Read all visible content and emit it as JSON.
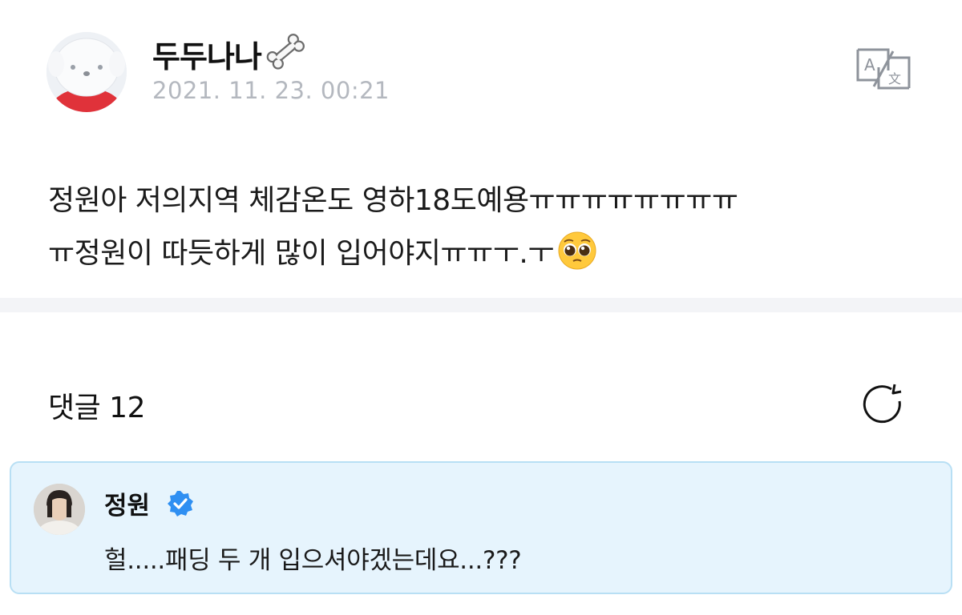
{
  "post": {
    "author": "두두나나",
    "timestamp": "2021. 11. 23. 00:21",
    "body_lines": [
      "정원아  저의지역 체감온도 영하18도예용ㅠㅠㅠㅠㅠㅠㅠㅠ",
      "ㅠ정원이 따듯하게 많이 입어야지ㅠㅠㅜ.ㅜ"
    ],
    "emoji": "pleading-face",
    "author_badge_icon": "bone-icon"
  },
  "comments": {
    "label": "댓글 12"
  },
  "comment": {
    "author": "정원",
    "text": "헐.....패딩 두 개 입으셔야겠는데요...???",
    "verified": true,
    "highlight_bg": "#e6f4fd",
    "highlight_border": "#b8dff4"
  },
  "colors": {
    "timestamp": "#b4b8bf",
    "verified": "#2f8ff2",
    "divider": "#f3f4f7"
  }
}
